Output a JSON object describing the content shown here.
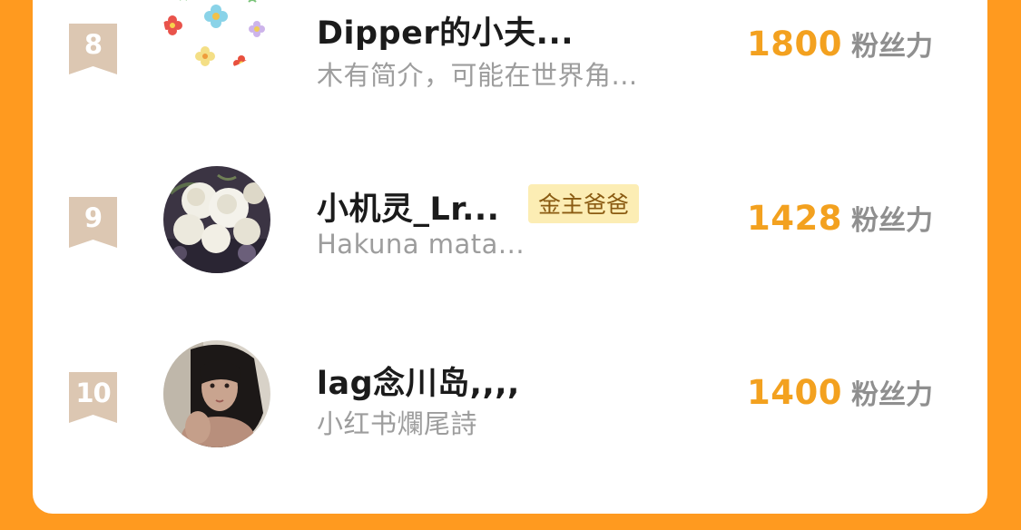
{
  "ranking": {
    "score_unit": "粉丝力",
    "rows": [
      {
        "rank": "8",
        "name": "Dipper的小夫...",
        "badge": "",
        "bio": "木有简介，可能在世界角...",
        "score": "1800",
        "avatar": "flower-pattern-avatar"
      },
      {
        "rank": "9",
        "name": "小机灵_Lr...",
        "badge": "金主爸爸",
        "bio": "Hakuna mata...",
        "score": "1428",
        "avatar": "white-roses-avatar"
      },
      {
        "rank": "10",
        "name": "lag念川岛,,,,",
        "badge": "",
        "bio": "小红书爛尾詩",
        "score": "1400",
        "avatar": "portrait-photo-avatar"
      }
    ]
  },
  "colors": {
    "background": "#FF9A1F",
    "card": "#FFFFFF",
    "score": "#F3A11F",
    "ribbon": "#DCC7B2",
    "badge_bg": "#FCEDB4",
    "badge_text": "#8A5B12"
  }
}
